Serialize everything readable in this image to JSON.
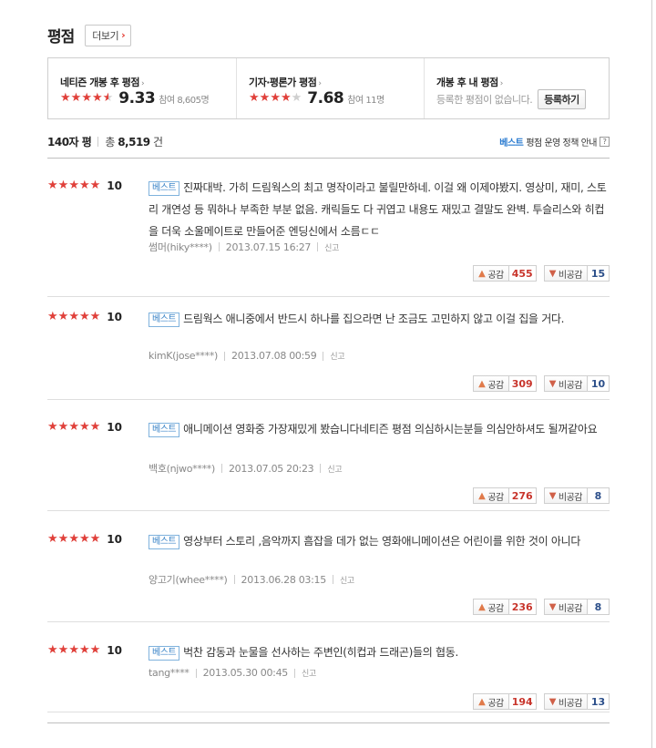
{
  "header": {
    "title": "평점",
    "more_label": "더보기"
  },
  "summary": {
    "netizen": {
      "label": "네티즌 개봉 후 평점",
      "score": "9.33",
      "participants": "참여 8,605명",
      "stars": [
        1,
        1,
        1,
        1,
        0.5
      ]
    },
    "critic": {
      "label": "기자·평론가 평점",
      "score": "7.68",
      "participants": "참여 11명",
      "stars": [
        1,
        1,
        1,
        1,
        0
      ]
    },
    "mine": {
      "label": "개봉 후 내 평점",
      "empty_text": "등록한 평점이 없습니다.",
      "register_label": "등록하기"
    }
  },
  "counts": {
    "type_label": "140자 평",
    "total_label": "총",
    "total": "8,519",
    "unit": "건"
  },
  "policy": {
    "best_label": "베스트",
    "rest_label": "평점 운영 정책 안내",
    "help": "?"
  },
  "vote_labels": {
    "like": "공감",
    "dislike": "비공감"
  },
  "report_label": "신고",
  "reviews": [
    {
      "score": "10",
      "badge": "베스트",
      "text": "진짜대박. 가히 드림웍스의 최고 명작이라고 불릴만하네. 이걸 왜 이제야봤지. 영상미, 재미, 스토리 개연성 등 뭐하나 부족한 부분 없음. 캐릭들도 다 귀엽고 내용도 재밌고 결말도 완벽. 투슬리스와 히컵을 더욱 소울메이트로 만들어준 엔딩신에서 소름ㄷㄷ",
      "author": "썸머(hiky****)",
      "date": "2013.07.15 16:27",
      "likes": "455",
      "dislikes": "15"
    },
    {
      "score": "10",
      "badge": "베스트",
      "text": "드림웍스 애니중에서 반드시 하나를 집으라면 난 조금도 고민하지 않고 이걸 집을 거다.",
      "author": "kimK(jose****)",
      "date": "2013.07.08 00:59",
      "likes": "309",
      "dislikes": "10"
    },
    {
      "score": "10",
      "badge": "베스트",
      "text": "애니메이션 영화중 가장재밌게 봤습니다네티즌 평점 의심하시는분들 의심안하셔도 될꺼같아요",
      "author": "백호(njwo****)",
      "date": "2013.07.05 20:23",
      "likes": "276",
      "dislikes": "8"
    },
    {
      "score": "10",
      "badge": "베스트",
      "text": "영상부터 스토리 ,음악까지 흠잡을 데가 없는 영화애니메이션은 어린이를 위한 것이 아니다",
      "author": "양고기(whee****)",
      "date": "2013.06.28 03:15",
      "likes": "236",
      "dislikes": "8"
    },
    {
      "score": "10",
      "badge": "베스트",
      "text": "벅찬 감동과 눈물을 선사하는 주변인(히컵과 드래곤)들의 협동.",
      "author": "tang****",
      "date": "2013.05.30 00:45",
      "likes": "194",
      "dislikes": "13"
    }
  ]
}
